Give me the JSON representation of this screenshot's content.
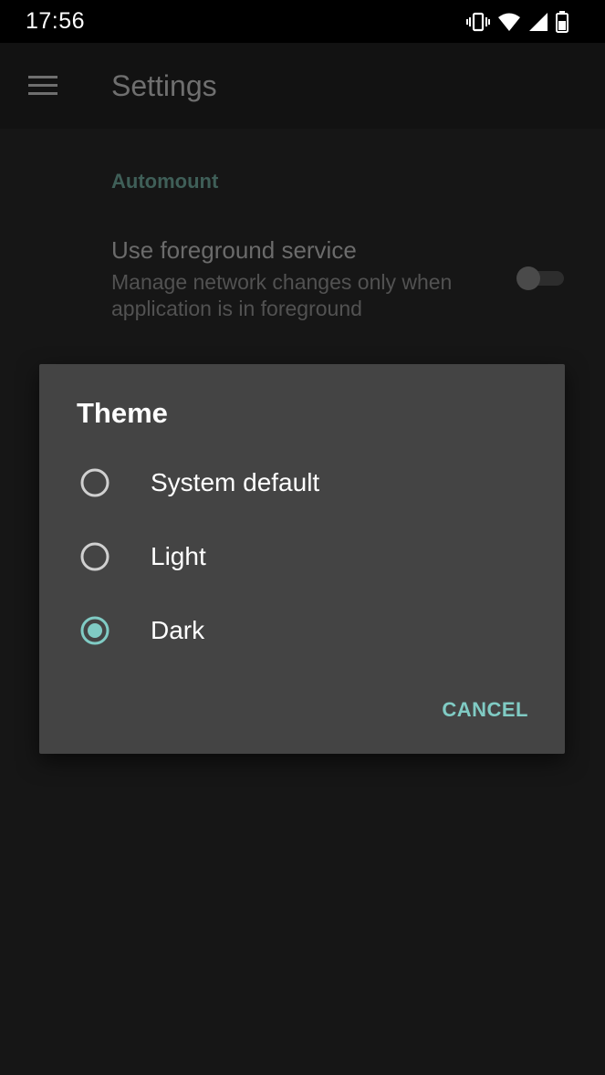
{
  "status_bar": {
    "time": "17:56",
    "icons": [
      "vibrate-icon",
      "wifi-icon",
      "signal-icon",
      "battery-icon"
    ]
  },
  "app_bar": {
    "menu_icon": "hamburger-menu-icon",
    "title": "Settings"
  },
  "settings": {
    "category": "Automount",
    "preference": {
      "title": "Use foreground service",
      "summary": "Manage network changes only when application is in foreground",
      "enabled": false
    }
  },
  "dialog": {
    "title": "Theme",
    "options": [
      {
        "label": "System default",
        "selected": false
      },
      {
        "label": "Light",
        "selected": false
      },
      {
        "label": "Dark",
        "selected": true
      }
    ],
    "cancel_label": "CANCEL"
  },
  "colors": {
    "accent": "#80cbc4",
    "dialog_background": "#444444",
    "screen_background": "#161616"
  }
}
